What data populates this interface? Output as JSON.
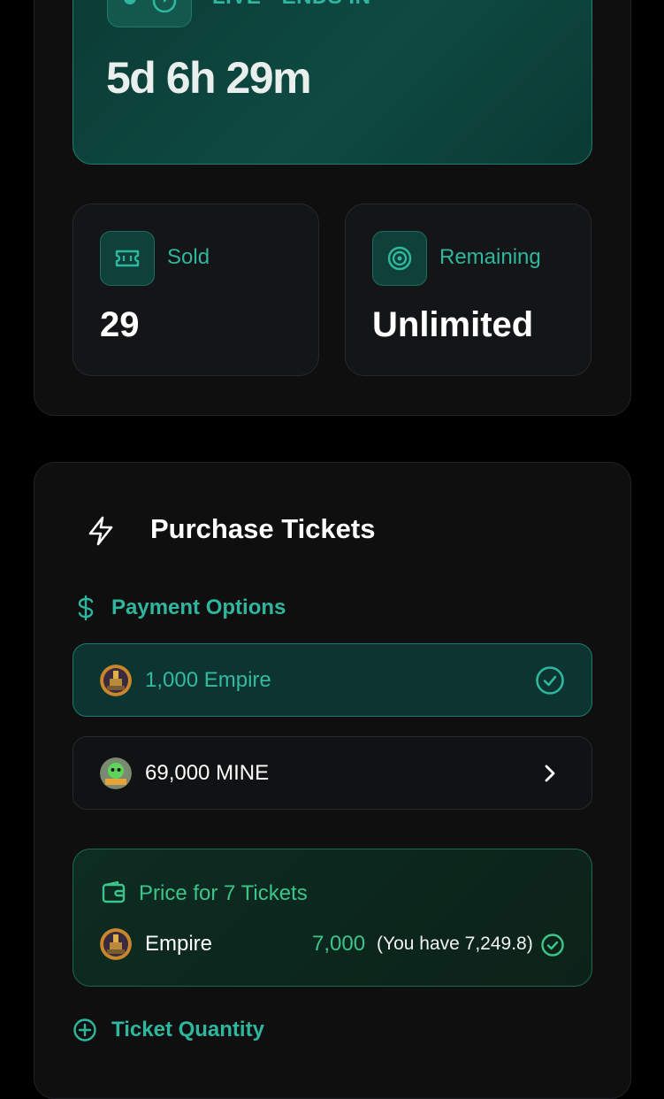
{
  "live": {
    "label": "LIVE • ENDS IN",
    "countdown": "5d 6h 29m"
  },
  "stats": {
    "sold": {
      "label": "Sold",
      "value": "29",
      "icon": "ticket-icon"
    },
    "remaining": {
      "label": "Remaining",
      "value": "Unlimited",
      "icon": "target-icon"
    }
  },
  "purchase": {
    "title": "Purchase Tickets",
    "payment_header": "Payment Options",
    "options": [
      {
        "label": "1,000 Empire",
        "selected": true,
        "icon": "check-circle-icon"
      },
      {
        "label": "69,000 MINE",
        "selected": false,
        "icon": "chevron-right-icon"
      }
    ],
    "price": {
      "title": "Price for 7 Tickets",
      "token": "Empire",
      "amount": "7,000",
      "balance": "(You have 7,249.8)"
    },
    "quantity_header": "Ticket Quantity"
  },
  "colors": {
    "accent": "#2eb79e",
    "price_green": "#3cc58a",
    "background": "#000000",
    "card": "#0f0f10"
  }
}
